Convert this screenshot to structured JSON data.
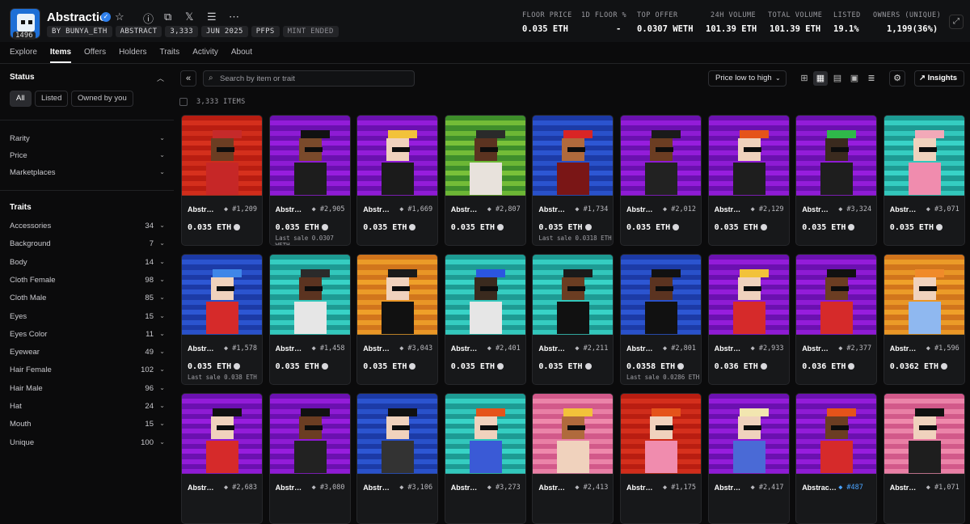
{
  "collection": {
    "title": "Abstractio",
    "logo_count": "1496",
    "chips": [
      "BY BUNYA_ETH",
      "ABSTRACT",
      "3,333",
      "JUN 2025",
      "PFPS",
      "MINT ENDED"
    ]
  },
  "stats": [
    {
      "label": "FLOOR PRICE",
      "value": "0.035 ETH"
    },
    {
      "label": "1D FLOOR %",
      "value": "-"
    },
    {
      "label": "TOP OFFER",
      "value": "0.0307 WETH"
    },
    {
      "label": "24H VOLUME",
      "value": "101.39 ETH"
    },
    {
      "label": "TOTAL VOLUME",
      "value": "101.39 ETH"
    },
    {
      "label": "LISTED",
      "value": "19.1%"
    },
    {
      "label": "OWNERS (UNIQUE)",
      "value": "1,199(36%)"
    }
  ],
  "tabs": [
    "Explore",
    "Items",
    "Offers",
    "Holders",
    "Traits",
    "Activity",
    "About"
  ],
  "sidebar": {
    "status_title": "Status",
    "status_buttons": [
      "All",
      "Listed",
      "Owned by you"
    ],
    "filters": [
      "Rarity",
      "Price",
      "Marketplaces"
    ],
    "traits_title": "Traits",
    "traits": [
      {
        "name": "Accessories",
        "count": "34"
      },
      {
        "name": "Background",
        "count": "7"
      },
      {
        "name": "Body",
        "count": "14"
      },
      {
        "name": "Cloth Female",
        "count": "98"
      },
      {
        "name": "Cloth Male",
        "count": "85"
      },
      {
        "name": "Eyes",
        "count": "15"
      },
      {
        "name": "Eyes Color",
        "count": "11"
      },
      {
        "name": "Eyewear",
        "count": "49"
      },
      {
        "name": "Hair Female",
        "count": "102"
      },
      {
        "name": "Hair Male",
        "count": "96"
      },
      {
        "name": "Hat",
        "count": "24"
      },
      {
        "name": "Mouth",
        "count": "15"
      },
      {
        "name": "Unique",
        "count": "100"
      }
    ]
  },
  "toolbar": {
    "search_placeholder": "Search by item or trait",
    "sort_label": "Price low to high",
    "insights_label": "Insights",
    "items_count": "3,333 ITEMS"
  },
  "items": [
    {
      "name": "Abstr…",
      "token": "#1,209",
      "price": "0.035 ETH",
      "last": "",
      "bg": [
        "#d8331f",
        "#b81e12"
      ],
      "skin": "#6b3d22",
      "hair": "#c52a2a",
      "shirt": "#c62727"
    },
    {
      "name": "Abstr…",
      "token": "#2,905",
      "price": "0.035 ETH",
      "last": "Last sale 0.0307 WETH",
      "bg": [
        "#9a1fe0",
        "#6b11b0"
      ],
      "skin": "#7a4a2b",
      "hair": "#111111",
      "shirt": "#1d1d1d"
    },
    {
      "name": "Abstr…",
      "token": "#1,669",
      "price": "0.035 ETH",
      "last": "",
      "bg": [
        "#9a1fe0",
        "#6b11b0"
      ],
      "skin": "#f0d2bd",
      "hair": "#f2c23a",
      "shirt": "#1b1b1b"
    },
    {
      "name": "Abstr…",
      "token": "#2,807",
      "price": "0.035 ETH",
      "last": "",
      "bg": [
        "#7cc43a",
        "#3f8e2b"
      ],
      "skin": "#5b3320",
      "hair": "#2a2a2a",
      "shirt": "#e8e2dc"
    },
    {
      "name": "Abstr…",
      "token": "#1,734",
      "price": "0.035 ETH",
      "last": "Last sale 0.0318 ETH",
      "bg": [
        "#2e59d6",
        "#1c3ba6"
      ],
      "skin": "#b06a3c",
      "hair": "#d92525",
      "shirt": "#7a1616"
    },
    {
      "name": "Abstr…",
      "token": "#2,012",
      "price": "0.035 ETH",
      "last": "",
      "bg": [
        "#9a1fe0",
        "#6b11b0"
      ],
      "skin": "#6b3d22",
      "hair": "#1a1a1a",
      "shirt": "#222222"
    },
    {
      "name": "Abstr…",
      "token": "#2,129",
      "price": "0.035 ETH",
      "last": "",
      "bg": [
        "#9a1fe0",
        "#6b11b0"
      ],
      "skin": "#f0d2bd",
      "hair": "#e5531a",
      "shirt": "#1e1e1e"
    },
    {
      "name": "Abstr…",
      "token": "#3,324",
      "price": "0.035 ETH",
      "last": "",
      "bg": [
        "#9a1fe0",
        "#6b11b0"
      ],
      "skin": "#3a2a1e",
      "hair": "#2fb84a",
      "shirt": "#1e1e1e"
    },
    {
      "name": "Abstr…",
      "token": "#3,071",
      "price": "0.035 ETH",
      "last": "",
      "bg": [
        "#3ad6c9",
        "#1e9b93"
      ],
      "skin": "#f0d2bd",
      "hair": "#f2a9b8",
      "shirt": "#f08cae"
    },
    {
      "name": "Abstr…",
      "token": "#1,578",
      "price": "0.035 ETH",
      "last": "Last sale 0.038 ETH",
      "bg": [
        "#2e59d6",
        "#1c3ba6"
      ],
      "skin": "#f0d2bd",
      "hair": "#3f86e8",
      "shirt": "#d62a2a"
    },
    {
      "name": "Abstr…",
      "token": "#1,458",
      "price": "0.035 ETH",
      "last": "",
      "bg": [
        "#3ad6c9",
        "#1e9b93"
      ],
      "skin": "#5b3320",
      "hair": "#2a2a2a",
      "shirt": "#e6e6e6"
    },
    {
      "name": "Abstr…",
      "token": "#3,043",
      "price": "0.035 ETH",
      "last": "",
      "bg": [
        "#f0a22a",
        "#d1761c"
      ],
      "skin": "#f0d2bd",
      "hair": "#1a1a1a",
      "shirt": "#111111"
    },
    {
      "name": "Abstr…",
      "token": "#2,401",
      "price": "0.035 ETH",
      "last": "",
      "bg": [
        "#3ad6c9",
        "#1e9b93"
      ],
      "skin": "#3a2a1e",
      "hair": "#2b56e0",
      "shirt": "#e6e6e6"
    },
    {
      "name": "Abstr…",
      "token": "#2,211",
      "price": "0.035 ETH",
      "last": "",
      "bg": [
        "#3ad6c9",
        "#1e9b93"
      ],
      "skin": "#6b3d22",
      "hair": "#1a1a1a",
      "shirt": "#111111"
    },
    {
      "name": "Abstr…",
      "token": "#2,801",
      "price": "0.0358 ETH",
      "last": "Last sale 0.0286 ETH",
      "bg": [
        "#2e59d6",
        "#1c3ba6"
      ],
      "skin": "#5b3320",
      "hair": "#111111",
      "shirt": "#111111"
    },
    {
      "name": "Abstr…",
      "token": "#2,933",
      "price": "0.036 ETH",
      "last": "",
      "bg": [
        "#9a1fe0",
        "#6b11b0"
      ],
      "skin": "#f0d2bd",
      "hair": "#f2c23a",
      "shirt": "#d62a2a"
    },
    {
      "name": "Abstr…",
      "token": "#2,377",
      "price": "0.036 ETH",
      "last": "",
      "bg": [
        "#9a1fe0",
        "#6b11b0"
      ],
      "skin": "#6b3d22",
      "hair": "#111111",
      "shirt": "#d62a2a"
    },
    {
      "name": "Abstr…",
      "token": "#1,596",
      "price": "0.0362 ETH",
      "last": "",
      "bg": [
        "#f0a22a",
        "#d1761c"
      ],
      "skin": "#f0d2bd",
      "hair": "#f08a2a",
      "shirt": "#8fb8f0"
    },
    {
      "name": "Abstr…",
      "token": "#2,683",
      "price": "",
      "last": "",
      "bg": [
        "#9a1fe0",
        "#6b11b0"
      ],
      "skin": "#f0d2bd",
      "hair": "#111111",
      "shirt": "#d62a2a"
    },
    {
      "name": "Abstr…",
      "token": "#3,080",
      "price": "",
      "last": "",
      "bg": [
        "#9a1fe0",
        "#6b11b0"
      ],
      "skin": "#6b3d22",
      "hair": "#111111",
      "shirt": "#222222"
    },
    {
      "name": "Abstr…",
      "token": "#3,106",
      "price": "",
      "last": "",
      "bg": [
        "#2e59d6",
        "#1c3ba6"
      ],
      "skin": "#f0d2bd",
      "hair": "#111111",
      "shirt": "#333333"
    },
    {
      "name": "Abstr…",
      "token": "#3,273",
      "price": "",
      "last": "",
      "bg": [
        "#3ad6c9",
        "#1e9b93"
      ],
      "skin": "#f0d2bd",
      "hair": "#e5531a",
      "shirt": "#3a5ad6"
    },
    {
      "name": "Abstr…",
      "token": "#2,413",
      "price": "",
      "last": "",
      "bg": [
        "#f08cae",
        "#d25a8a"
      ],
      "skin": "#b06a3c",
      "hair": "#f2c23a",
      "shirt": "#f0d2bd"
    },
    {
      "name": "Abstr…",
      "token": "#1,175",
      "price": "",
      "last": "",
      "bg": [
        "#d8331f",
        "#b81e12"
      ],
      "skin": "#f0d2bd",
      "hair": "#e5531a",
      "shirt": "#f08cae"
    },
    {
      "name": "Abstr…",
      "token": "#2,417",
      "price": "",
      "last": "",
      "bg": [
        "#9a1fe0",
        "#6b11b0"
      ],
      "skin": "#f0d2bd",
      "hair": "#f2e6b0",
      "shirt": "#4a6ad6"
    },
    {
      "name": "Abstrac…",
      "token": "#487",
      "price": "",
      "last": "",
      "bg": [
        "#9a1fe0",
        "#6b11b0"
      ],
      "skin": "#6b3d22",
      "hair": "#e5531a",
      "shirt": "#d62a2a"
    },
    {
      "name": "Abstr…",
      "token": "#1,071",
      "price": "",
      "last": "",
      "bg": [
        "#f08cae",
        "#d25a8a"
      ],
      "skin": "#f0d2bd",
      "hair": "#111111",
      "shirt": "#1e1e1e"
    }
  ]
}
